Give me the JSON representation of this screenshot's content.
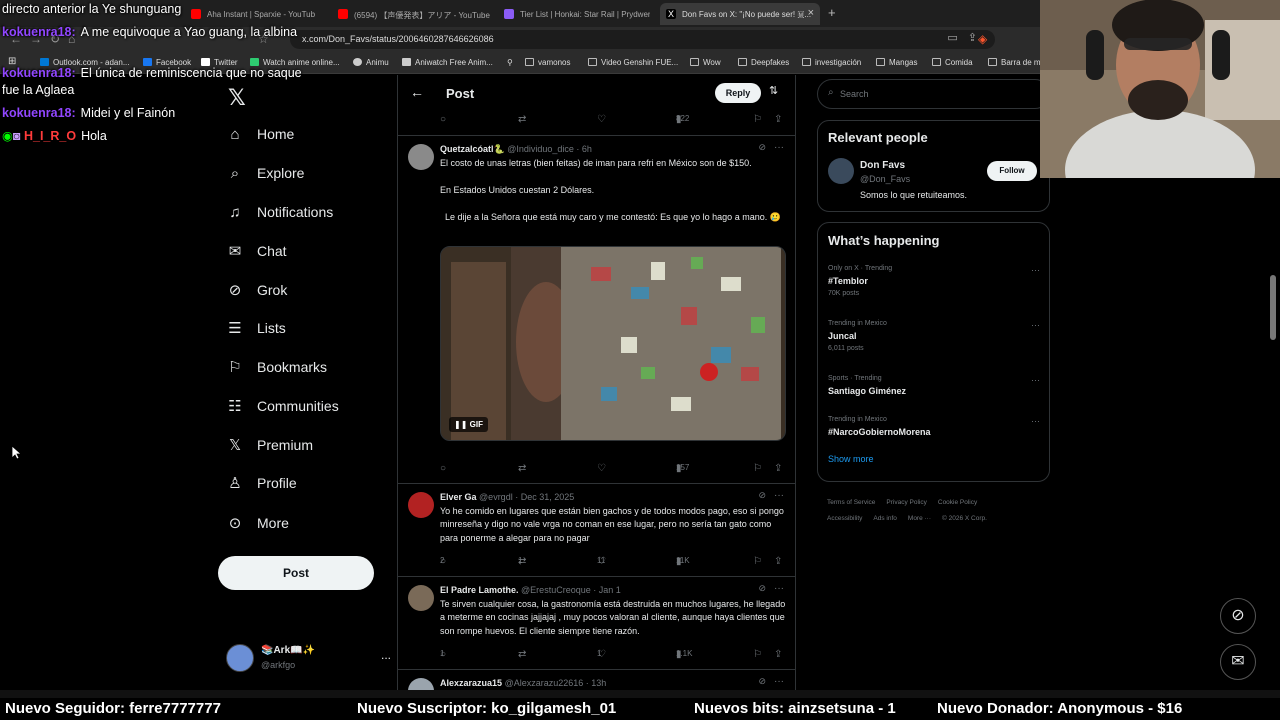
{
  "browser": {
    "tabs": [
      {
        "title": "[声優発表]アリア - YouTube",
        "full": "(6594) 【声優発表】アリア - YouTube",
        "color": "#ff0000"
      },
      {
        "title": "Tier List | Honkai: Star Rail | Prydwen",
        "color": "#8b5cf6"
      },
      {
        "title": "Don Favs on X: \"¡No puede ser! 🇲...",
        "color": "#ffffff",
        "active": true
      }
    ],
    "tab_partial_1": "Aha Instant | Sparxie - YouTub",
    "url": "x.com/Don_Favs/status/2006460287646626086",
    "bookmarks": [
      {
        "label": "Outlook.com - adan...",
        "color": "#0078d4"
      },
      {
        "label": "Facebook",
        "color": "#1877f2"
      },
      {
        "label": "Twitter",
        "color": "#ffffff"
      },
      {
        "label": "Watch anime online...",
        "color": "#2ecc71"
      },
      {
        "label": "Animu",
        "color": "#cccccc"
      },
      {
        "label": "Aniwatch Free Anim...",
        "color": "#cccccc"
      },
      {
        "label": "vamonos",
        "color": "#999999"
      },
      {
        "label": "Video Genshin FUE...",
        "color": "#999999"
      },
      {
        "label": "Wow",
        "color": "#999999"
      },
      {
        "label": "Deepfakes",
        "color": "#999999"
      },
      {
        "label": "investigación",
        "color": "#999999"
      },
      {
        "label": "Mangas",
        "color": "#999999"
      },
      {
        "label": "Comida",
        "color": "#999999"
      },
      {
        "label": "Barra de m",
        "color": "#999999"
      }
    ]
  },
  "chat": [
    {
      "user": "",
      "text": "directo anterior la Ye shunguang",
      "color": "#ffffff"
    },
    {
      "user": "kokuenra18:",
      "text": "A me equivoque a Yao guang, la albina",
      "color": "#9146ff"
    },
    {
      "user": "kokuenra18:",
      "text": "El única de reminiscencia que no saque fue la Aglaea",
      "color": "#9146ff"
    },
    {
      "user": "kokuenra18:",
      "text": "Midei y el Fainón",
      "color": "#9146ff"
    },
    {
      "user": "H_I_R_O",
      "text": "Hola",
      "color": "#ff3b3b"
    }
  ],
  "nav": {
    "items": [
      {
        "label": "Home",
        "icon": "home-icon",
        "glyph": "⌂"
      },
      {
        "label": "Explore",
        "icon": "search-icon",
        "glyph": "⌕"
      },
      {
        "label": "Notifications",
        "icon": "bell-icon",
        "glyph": "🔔"
      },
      {
        "label": "Chat",
        "icon": "envelope-icon",
        "glyph": "✉"
      },
      {
        "label": "Grok",
        "icon": "grok-icon",
        "glyph": "⊘"
      },
      {
        "label": "Lists",
        "icon": "list-icon",
        "glyph": "☰"
      },
      {
        "label": "Bookmarks",
        "icon": "bookmark-icon",
        "glyph": "⚑"
      },
      {
        "label": "Communities",
        "icon": "people-icon",
        "glyph": "☷"
      },
      {
        "label": "Premium",
        "icon": "x-logo-icon",
        "glyph": "𝕏"
      },
      {
        "label": "Profile",
        "icon": "person-icon",
        "glyph": "♙"
      },
      {
        "label": "More",
        "icon": "more-circle-icon",
        "glyph": "⋯"
      }
    ],
    "post_label": "Post",
    "account": {
      "name": "📚Ark📖✨",
      "handle": "@arkfgo",
      "more": "..."
    }
  },
  "header": {
    "title": "Post",
    "reply_label": "Reply"
  },
  "top_actions": {
    "views": "822"
  },
  "tweets": [
    {
      "name": "Quetzalcóatl🐍",
      "handle": "@Individuo_dice · 6h",
      "text": "El costo de unas letras (bien feitas) de iman para refri en México son de $150.\n\nEn Estados Unidos cuestan 2 Dólares.\n\n  Le dije a la Señora que está muy caro y me contestó: Es que yo lo hago a mano. 🥲",
      "gif_label": "GIF",
      "views": "157",
      "avatar_color": "#8a8a8a"
    },
    {
      "name": "Elver Ga",
      "handle": "@evrgdl · Dec 31, 2025",
      "text": "Yo he comido en lugares que están bien gachos y de todos modos pago, eso si pongo minreseña y digo no vale vrga no coman en ese lugar, pero no sería tan gato como para ponerme a alegar para no pagar",
      "replies": "2",
      "retweets": "1",
      "likes": "11",
      "views": "11K",
      "avatar_color": "#b22222"
    },
    {
      "name": "El Padre Lamothe.",
      "handle": "@ErestuCreoque · Jan 1",
      "text": "Te sirven cualquier cosa, la gastronomía está destruida en muchos lugares, he llegado a meterme en cocinas jajjajaj , muy pocos valoran al cliente, aunque haya clientes que son rompe huevos. El cliente siempre tiene razón.",
      "replies": "1",
      "retweets": "",
      "likes": "1",
      "views": "1.1K",
      "avatar_color": "#7a6a58"
    },
    {
      "name": "Alexzarazua15",
      "handle": "@Alexzarazu22616 · 13h",
      "avatar_color": "#9aa4ad"
    }
  ],
  "right": {
    "search_placeholder": "Search",
    "relevant_title": "Relevant people",
    "person": {
      "name": "Don Favs",
      "handle": "@Don_Favs",
      "bio": "Somos lo que retuiteamos.",
      "follow": "Follow"
    },
    "happening_title": "What’s happening",
    "trends": [
      {
        "context": "Only on X · Trending",
        "name": "#Temblor",
        "posts": "70K posts"
      },
      {
        "context": "Trending in Mexico",
        "name": "Juncal",
        "posts": "6,011 posts"
      },
      {
        "context": "Sports · Trending",
        "name": "Santiago Giménez",
        "posts": ""
      },
      {
        "context": "Trending in Mexico",
        "name": "#NarcoGobiernoMorena",
        "posts": ""
      }
    ],
    "show_more": "Show more",
    "footer": [
      "Terms of Service",
      "Privacy Policy",
      "Cookie Policy",
      "Accessibility",
      "Ads info",
      "More ···",
      "© 2026 X Corp."
    ]
  },
  "ticker": [
    "Nuevo Seguidor: ferre7777777",
    "Nuevo Suscriptor: ko_gilgamesh_01",
    "Nuevos bits: ainzsetsuna - 1",
    "Nuevo Donador: Anonymous - $16"
  ]
}
